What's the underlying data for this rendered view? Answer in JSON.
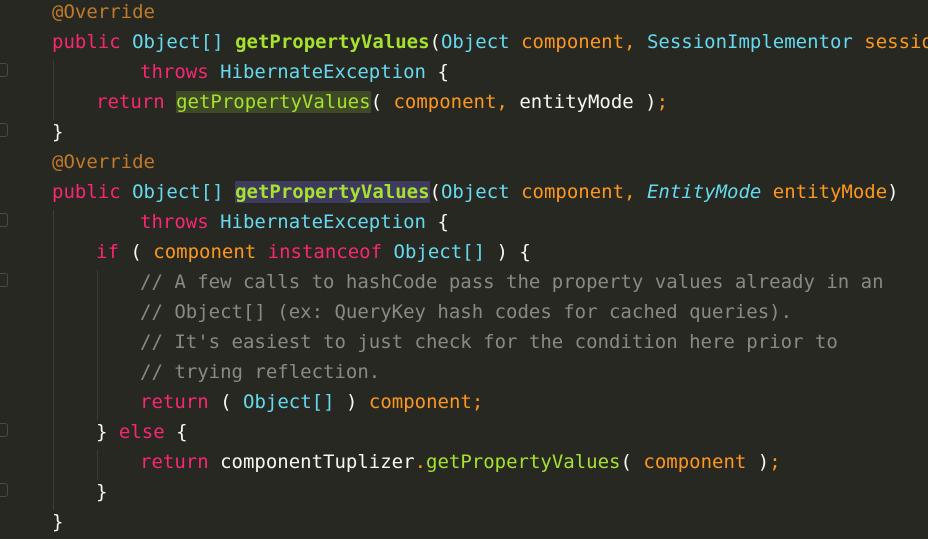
{
  "colors": {
    "background": "#272822",
    "keyword": "#f92672",
    "type": "#66d9ef",
    "function": "#a6e22e",
    "parameter": "#fd971f",
    "annotation": "#c07a2a",
    "comment": "#8a8a80",
    "text": "#f8f8f2",
    "usage_highlight": "#3e4a25",
    "definition_highlight": "#3e3b5e"
  },
  "code": {
    "l1": {
      "ann": "@Override"
    },
    "l2": {
      "public": "public",
      "ret": "Object[]",
      "name": "getPropertyValues",
      "open": "(",
      "t1": "Object",
      "p1": "component",
      "c1": ",",
      "t2": "SessionImplementor",
      "p2": "session",
      "close": ")"
    },
    "l3": {
      "throws": "throws",
      "exc": "HibernateException",
      "brace": "{"
    },
    "l4": {
      "return": "return",
      "call": "getPropertyValues",
      "open": "(",
      "a1": "component",
      "comma": ",",
      "a2": "entityMode",
      "close": ")",
      "semi": ";"
    },
    "l5": {
      "brace": "}"
    },
    "l6": {
      "ann": "@Override"
    },
    "l7": {
      "public": "public",
      "ret": "Object[]",
      "name": "getPropertyValues",
      "open": "(",
      "t1": "Object",
      "p1": "component",
      "c1": ",",
      "t2": "EntityMode",
      "p2": "entityMode",
      "close": ")"
    },
    "l8": {
      "throws": "throws",
      "exc": "HibernateException",
      "brace": "{"
    },
    "l9": {
      "if": "if",
      "open": "(",
      "var": "component",
      "instanceof": "instanceof",
      "type": "Object[]",
      "close": ")",
      "brace": "{"
    },
    "l10": {
      "comment": "// A few calls to hashCode pass the property values already in an"
    },
    "l11": {
      "comment": "// Object[] (ex: QueryKey hash codes for cached queries)."
    },
    "l12": {
      "comment": "// It's easiest to just check for the condition here prior to"
    },
    "l13": {
      "comment": "// trying reflection."
    },
    "l14": {
      "return": "return",
      "open": "(",
      "type": "Object[]",
      "close": ")",
      "var": "component",
      "semi": ";"
    },
    "l15": {
      "close": "}",
      "else": "else",
      "brace": "{"
    },
    "l16": {
      "return": "return",
      "obj": "componentTuplizer",
      "dot": ".",
      "call": "getPropertyValues",
      "open": "(",
      "arg": "component",
      "close": ")",
      "semi": ";"
    },
    "l17": {
      "brace": "}"
    },
    "l18": {
      "brace": "}"
    }
  }
}
